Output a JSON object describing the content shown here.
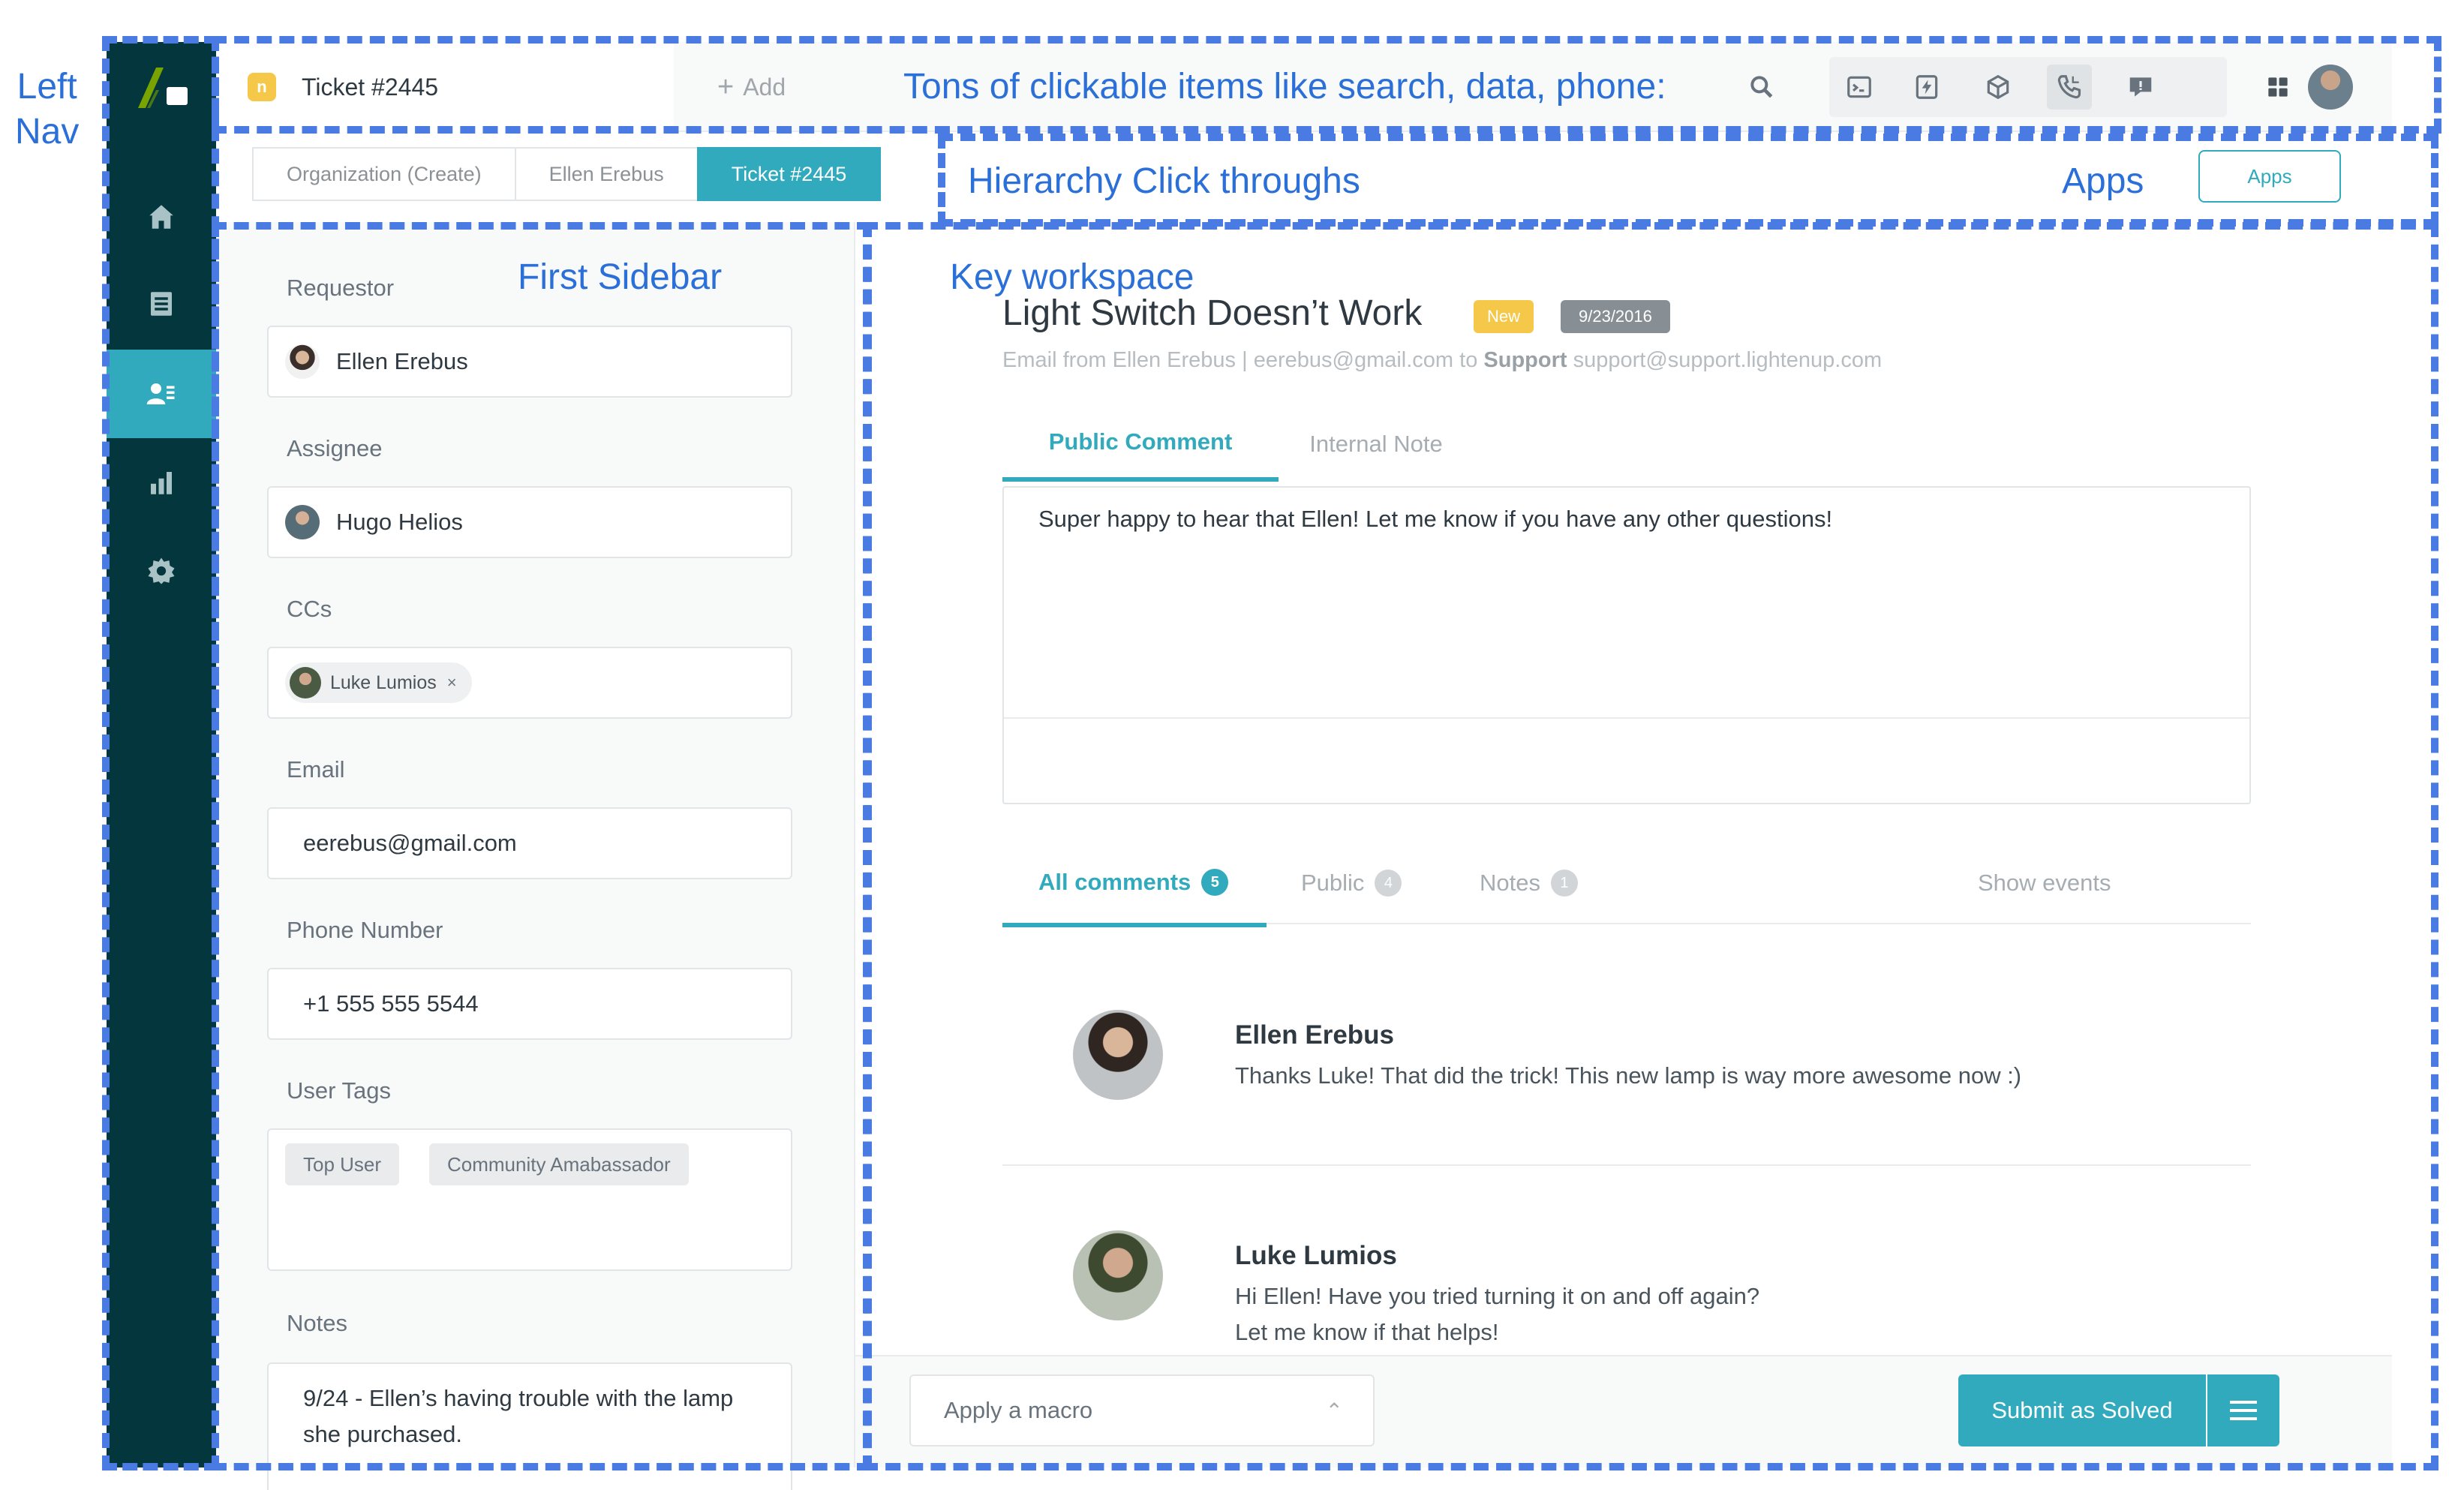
{
  "annotations": {
    "left_nav": "Left\nNav",
    "toolbar_note": "Tons of clickable items like search, data, phone:",
    "hierarchy": "Hierarchy Click throughs",
    "apps": "Apps",
    "first_sidebar": "First Sidebar",
    "key_workspace": "Key workspace"
  },
  "colors": {
    "accent": "#30aabc",
    "nav_bg": "#03363d",
    "annotation": "#4a7be2",
    "badge_new": "#f5c84a"
  },
  "nav": {
    "logo": "zendesk-logo",
    "items": [
      {
        "icon": "home-icon"
      },
      {
        "icon": "views-icon"
      },
      {
        "icon": "customers-icon",
        "active": true
      },
      {
        "icon": "reporting-icon"
      },
      {
        "icon": "gear-icon"
      }
    ]
  },
  "topbar": {
    "ticket_badge": "n",
    "ticket_tab": "Ticket #2445",
    "add_plus": "+",
    "add_label": "Add",
    "icons": [
      "search-icon",
      "terminal-icon",
      "lightning-icon",
      "box-icon",
      "phone-icon",
      "chat-icon",
      "apps-grid-icon",
      "user-avatar"
    ]
  },
  "breadcrumb": {
    "items": [
      "Organization (Create)",
      "Ellen Erebus",
      "Ticket #2445"
    ],
    "apps_button": "Apps"
  },
  "sidebar": {
    "requester_label": "Requestor",
    "requester_value": "Ellen Erebus",
    "assignee_label": "Assignee",
    "assignee_value": "Hugo Helios",
    "ccs_label": "CCs",
    "cc_chip": "Luke Lumios",
    "cc_remove": "×",
    "email_label": "Email",
    "email_value": "eerebus@gmail.com",
    "phone_label": "Phone Number",
    "phone_value": "+1 555 555 5544",
    "tags_label": "User Tags",
    "tags": [
      "Top User",
      "Community Amabassador"
    ],
    "notes_label": "Notes",
    "notes_value": "9/24 - Ellen’s having trouble with the lamp she purchased."
  },
  "workspace": {
    "title": "Light Switch Doesn’t Work",
    "status_badge": "New",
    "date_badge": "9/23/2016",
    "meta_prefix": "Email from Ellen Erebus  |  eerebus@gmail.com to ",
    "meta_bold": "Support",
    "meta_suffix": " support@support.lightenup.com",
    "compose_tabs": [
      "Public Comment",
      "Internal Note"
    ],
    "composer_text": "Super happy to hear that Ellen! Let me know if you have any other questions!",
    "filters": {
      "all_label": "All comments",
      "all_count": "5",
      "public_label": "Public",
      "public_count": "4",
      "notes_label": "Notes",
      "notes_count": "1",
      "show_events": "Show events"
    },
    "comments": [
      {
        "author": "Ellen Erebus",
        "body": "Thanks Luke! That did the trick! This new lamp is way more awesome now :)"
      },
      {
        "author": "Luke Lumios",
        "body_line1": "Hi Ellen! Have you tried turning it on and off again?",
        "body_line2": "Let me know if that helps!"
      }
    ]
  },
  "footer": {
    "macro_placeholder": "Apply a macro",
    "macro_chevron": "⌃",
    "submit_label": "Submit as Solved"
  }
}
